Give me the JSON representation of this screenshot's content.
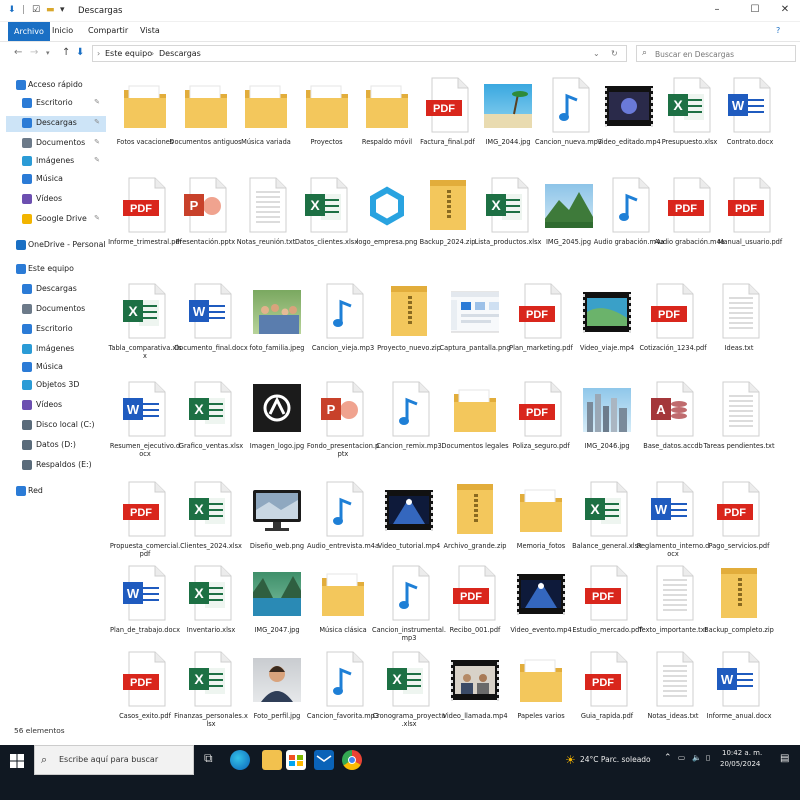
{
  "window": {
    "title": "Descargas",
    "tabs": [
      "Archivo",
      "Inicio",
      "Compartir",
      "Vista"
    ],
    "breadcrumb": [
      "Este equipo",
      "Descargas"
    ],
    "search_placeholder": "Buscar en Descargas"
  },
  "sidebar": {
    "items": [
      {
        "label": "Acceso rápido",
        "icon": "star-icon",
        "pinned": false,
        "selected": false,
        "color": "#2b7bd6",
        "level": 0
      },
      {
        "label": "Escritorio",
        "icon": "desktop-icon",
        "pinned": true,
        "selected": false,
        "color": "#2b7bd6",
        "level": 1
      },
      {
        "label": "Descargas",
        "icon": "download-icon",
        "pinned": true,
        "selected": true,
        "color": "#2b7bd6",
        "level": 1
      },
      {
        "label": "Documentos",
        "icon": "documents-icon",
        "pinned": true,
        "selected": false,
        "color": "#6c7a89",
        "level": 1
      },
      {
        "label": "Imágenes",
        "icon": "pictures-icon",
        "pinned": true,
        "selected": false,
        "color": "#2b9bd6",
        "level": 1
      },
      {
        "label": "Música",
        "icon": "music-icon",
        "pinned": false,
        "selected": false,
        "color": "#2b7bd6",
        "level": 1
      },
      {
        "label": "Vídeos",
        "icon": "videos-icon",
        "pinned": false,
        "selected": false,
        "color": "#6c4fb0",
        "level": 1
      },
      {
        "label": "Google Drive",
        "icon": "google-drive-icon",
        "pinned": true,
        "selected": false,
        "color": "#f2b400",
        "level": 1
      },
      {
        "label": "OneDrive - Personal",
        "icon": "onedrive-icon",
        "pinned": false,
        "selected": false,
        "color": "#1a6fc4",
        "level": 0
      },
      {
        "label": "Este equipo",
        "icon": "computer-icon",
        "pinned": false,
        "selected": false,
        "color": "#2b7bd6",
        "level": 0
      },
      {
        "label": "Descargas",
        "icon": "download-icon",
        "pinned": false,
        "selected": false,
        "color": "#2b7bd6",
        "level": 1
      },
      {
        "label": "Documentos",
        "icon": "documents-icon",
        "pinned": false,
        "selected": false,
        "color": "#6c7a89",
        "level": 1
      },
      {
        "label": "Escritorio",
        "icon": "desktop-icon",
        "pinned": false,
        "selected": false,
        "color": "#2b7bd6",
        "level": 1
      },
      {
        "label": "Imágenes",
        "icon": "pictures-icon",
        "pinned": false,
        "selected": false,
        "color": "#2b9bd6",
        "level": 1
      },
      {
        "label": "Música",
        "icon": "music-icon",
        "pinned": false,
        "selected": false,
        "color": "#2b7bd6",
        "level": 1
      },
      {
        "label": "Objetos 3D",
        "icon": "objects-3d-icon",
        "pinned": false,
        "selected": false,
        "color": "#2b9bd6",
        "level": 1
      },
      {
        "label": "Vídeos",
        "icon": "videos-icon",
        "pinned": false,
        "selected": false,
        "color": "#6c4fb0",
        "level": 1
      },
      {
        "label": "Disco local (C:)",
        "icon": "drive-icon",
        "pinned": false,
        "selected": false,
        "color": "#5a6b7a",
        "level": 1
      },
      {
        "label": "Datos (D:)",
        "icon": "drive-icon",
        "pinned": false,
        "selected": false,
        "color": "#5a6b7a",
        "level": 1
      },
      {
        "label": "Respaldos (E:)",
        "icon": "drive-icon",
        "pinned": false,
        "selected": false,
        "color": "#5a6b7a",
        "level": 1
      },
      {
        "label": "Red",
        "icon": "network-icon",
        "pinned": false,
        "selected": false,
        "color": "#2b7bd6",
        "level": 0
      }
    ]
  },
  "files": [
    [
      {
        "name": "Fotos vacaciones",
        "type": "folder"
      },
      {
        "name": "Documentos antiguos",
        "type": "folder"
      },
      {
        "name": "Música variada",
        "type": "folder"
      },
      {
        "name": "Proyectos",
        "type": "folder"
      },
      {
        "name": "Respaldo móvil",
        "type": "folder"
      },
      {
        "name": "Factura_final.pdf",
        "type": "pdf"
      },
      {
        "name": "IMG_2044.jpg",
        "type": "img-beach"
      },
      {
        "name": "Cancion_nueva.mp3",
        "type": "audio"
      },
      {
        "name": "Video_editado.mp4",
        "type": "video"
      },
      {
        "name": "Presupuesto.xlsx",
        "type": "excel"
      },
      {
        "name": "Contrato.docx",
        "type": "word"
      }
    ],
    [
      {
        "name": "Informe_trimestral.pdf",
        "type": "pdf"
      },
      {
        "name": "Presentación.pptx",
        "type": "ppt"
      },
      {
        "name": "Notas_reunión.txt",
        "type": "txt"
      },
      {
        "name": "Datos_clientes.xlsx",
        "type": "excel"
      },
      {
        "name": "logo_empresa.png",
        "type": "img-logo"
      },
      {
        "name": "Backup_2024.zip",
        "type": "zip"
      },
      {
        "name": "Lista_productos.xlsx",
        "type": "excel"
      },
      {
        "name": "IMG_2045.jpg",
        "type": "img-mountain"
      },
      {
        "name": "Audio grabación.m4a",
        "type": "audio"
      },
      {
        "name": "Audio grabación.m4a",
        "type": "pdf"
      },
      {
        "name": "Manual_usuario.pdf",
        "type": "pdf"
      }
    ],
    [
      {
        "name": "Tabla_comparativa.xlsx",
        "type": "excel"
      },
      {
        "name": "Documento_final.docx",
        "type": "word"
      },
      {
        "name": "foto_familia.jpeg",
        "type": "img-family"
      },
      {
        "name": "Cancion_vieja.mp3",
        "type": "audio"
      },
      {
        "name": "Proyecto_nuevo.zip",
        "type": "zip"
      },
      {
        "name": "Captura_pantalla.png",
        "type": "img-screenshot"
      },
      {
        "name": "Plan_marketing.pdf",
        "type": "pdf"
      },
      {
        "name": "Video_viaje.mp4",
        "type": "video-coast"
      },
      {
        "name": "Cotización_1234.pdf",
        "type": "pdf"
      },
      {
        "name": "Ideas.txt",
        "type": "txt"
      }
    ],
    [
      {
        "name": "Resumen_ejecutivo.docx",
        "type": "word"
      },
      {
        "name": "Grafico_ventas.xlsx",
        "type": "excel"
      },
      {
        "name": "Imagen_logo.jpg",
        "type": "img-darklogo"
      },
      {
        "name": "Fondo_presentacion.pptx",
        "type": "ppt"
      },
      {
        "name": "Cancion_remix.mp3",
        "type": "audio"
      },
      {
        "name": "Documentos legales",
        "type": "folder"
      },
      {
        "name": "Poliza_seguro.pdf",
        "type": "pdf"
      },
      {
        "name": "IMG_2046.jpg",
        "type": "img-city"
      },
      {
        "name": "Base_datos.accdb",
        "type": "access"
      },
      {
        "name": "Tareas pendientes.txt",
        "type": "txt"
      }
    ],
    [
      {
        "name": "Propuesta_comercial.pdf",
        "type": "pdf"
      },
      {
        "name": "Clientes_2024.xlsx",
        "type": "excel"
      },
      {
        "name": "Diseño_web.png",
        "type": "img-monitor"
      },
      {
        "name": "Audio_entrevista.m4a",
        "type": "audio"
      },
      {
        "name": "Video_tutorial.mp4",
        "type": "video-concert"
      },
      {
        "name": "Archivo_grande.zip",
        "type": "zip"
      },
      {
        "name": "Memoria_fotos",
        "type": "folder"
      },
      {
        "name": "Balance_general.xlsx",
        "type": "excel"
      },
      {
        "name": "Reglamento_interno.docx",
        "type": "word"
      },
      {
        "name": "Pago_servicios.pdf",
        "type": "pdf"
      }
    ],
    [
      {
        "name": "Plan_de_trabajo.docx",
        "type": "word"
      },
      {
        "name": "Inventario.xlsx",
        "type": "excel"
      },
      {
        "name": "IMG_2047.jpg",
        "type": "img-lake"
      },
      {
        "name": "Música clásica",
        "type": "folder"
      },
      {
        "name": "Cancion_instrumental.mp3",
        "type": "audio"
      },
      {
        "name": "Recibo_001.pdf",
        "type": "pdf"
      },
      {
        "name": "Video_evento.mp4",
        "type": "video-concert"
      },
      {
        "name": "Estudio_mercado.pdf",
        "type": "pdf"
      },
      {
        "name": "Texto_importante.txt",
        "type": "txt"
      },
      {
        "name": "Backup_completo.zip",
        "type": "zip"
      }
    ],
    [
      {
        "name": "Casos_exito.pdf",
        "type": "pdf"
      },
      {
        "name": "Finanzas_personales.xlsx",
        "type": "excel"
      },
      {
        "name": "Foto_perfil.jpg",
        "type": "img-portrait"
      },
      {
        "name": "Cancion_favorita.mp3",
        "type": "audio"
      },
      {
        "name": "Cronograma_proyecto.xlsx",
        "type": "excel"
      },
      {
        "name": "Video_llamada.mp4",
        "type": "video-call"
      },
      {
        "name": "Papeles varios",
        "type": "folder"
      },
      {
        "name": "Guia_rapida.pdf",
        "type": "pdf"
      },
      {
        "name": "Notas_ideas.txt",
        "type": "txt"
      },
      {
        "name": "Informe_anual.docx",
        "type": "word"
      }
    ]
  ],
  "status": {
    "count": "56 elementos"
  },
  "taskbar": {
    "search_placeholder": "Escribe aquí para buscar",
    "weather": "24°C  Parc. soleado",
    "time": "10:42 a. m.",
    "date": "20/05/2024"
  },
  "colors": {
    "accent": "#1a6fc4",
    "pdf": "#d9261c",
    "excel": "#1d7044",
    "word": "#1f5bbf",
    "ppt": "#c8412a",
    "access": "#a4373a",
    "folder": "#f3c75c",
    "audio": "#1e7fd6"
  }
}
